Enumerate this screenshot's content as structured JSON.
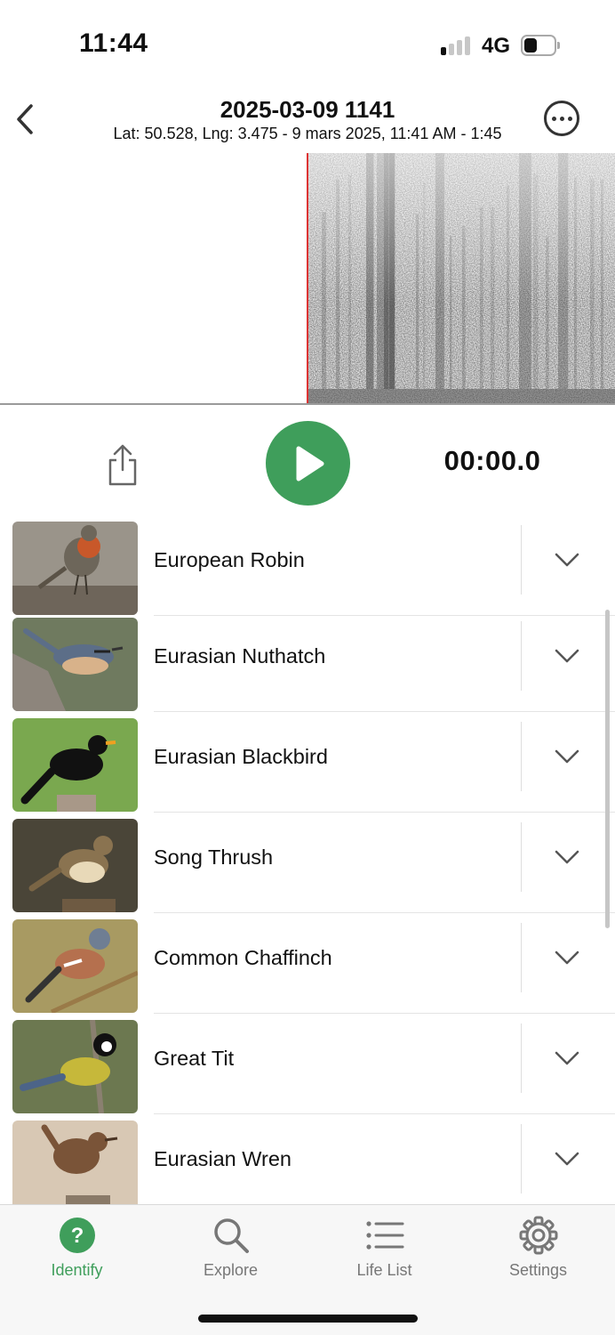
{
  "status_bar": {
    "time": "11:44",
    "network": "4G",
    "battery_level": 0.45,
    "signal_bars_on": 1,
    "signal_bars_total": 4
  },
  "header": {
    "title": "2025-03-09 1141",
    "subtitle": "Lat: 50.528, Lng: 3.475 - 9 mars 2025, 11:41 AM - 1:45",
    "back_icon": "chevron-left-icon",
    "more_icon": "ellipsis-circle-icon"
  },
  "player": {
    "time": "00:00.0",
    "play_icon": "play-icon",
    "share_icon": "share-icon"
  },
  "species": [
    {
      "name": "European Robin",
      "icon": "bird-photo"
    },
    {
      "name": "Eurasian Nuthatch",
      "icon": "bird-photo"
    },
    {
      "name": "Eurasian Blackbird",
      "icon": "bird-photo"
    },
    {
      "name": "Song Thrush",
      "icon": "bird-photo"
    },
    {
      "name": "Common Chaffinch",
      "icon": "bird-photo"
    },
    {
      "name": "Great Tit",
      "icon": "bird-photo"
    },
    {
      "name": "Eurasian Wren",
      "icon": "bird-photo"
    }
  ],
  "tabs": [
    {
      "label": "Identify",
      "icon": "question-circle-icon",
      "active": true
    },
    {
      "label": "Explore",
      "icon": "search-icon",
      "active": false
    },
    {
      "label": "Life List",
      "icon": "list-icon",
      "active": false
    },
    {
      "label": "Settings",
      "icon": "gear-icon",
      "active": false
    }
  ],
  "colors": {
    "accent": "#3f9e5b",
    "playhead": "#dd3333",
    "text": "#111111",
    "muted": "#777777"
  }
}
